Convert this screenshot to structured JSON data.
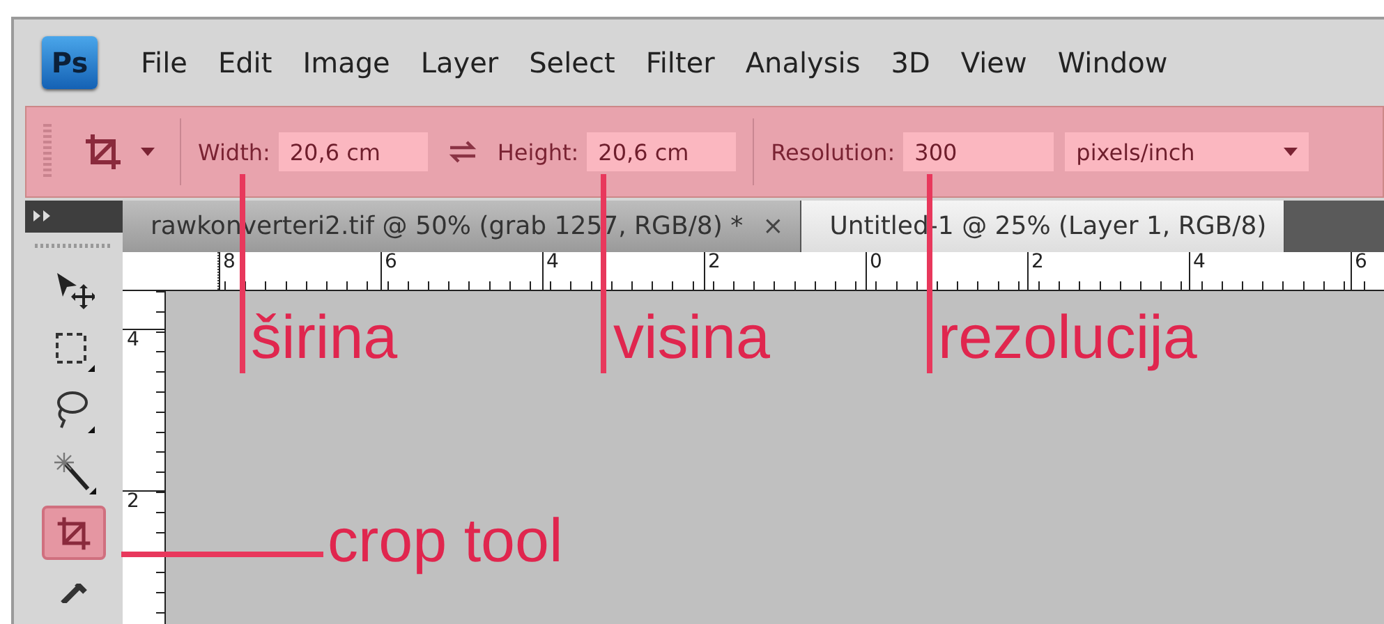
{
  "app_logo": "Ps",
  "menu_bar": {
    "items": [
      "File",
      "Edit",
      "Image",
      "Layer",
      "Select",
      "Filter",
      "Analysis",
      "3D",
      "View",
      "Window"
    ]
  },
  "options_bar": {
    "width_label": "Width:",
    "width_value": "20,6 cm",
    "height_label": "Height:",
    "height_value": "20,6 cm",
    "resolution_label": "Resolution:",
    "resolution_value": "300",
    "resolution_unit": "pixels/inch"
  },
  "tabs": [
    {
      "label": "rawkonverteri2.tif @ 50% (grab 1257, RGB/8) *",
      "close": "×",
      "selected": false
    },
    {
      "label": "Untitled-1 @ 25% (Layer 1, RGB/8)",
      "selected": true
    }
  ],
  "rulers": {
    "horizontal": [
      "8",
      "6",
      "4",
      "2",
      "0",
      "2",
      "4",
      "6"
    ],
    "vertical": [
      "4",
      "2"
    ]
  },
  "tools": [
    {
      "kind": "move",
      "selected": false
    },
    {
      "kind": "marquee",
      "selected": false
    },
    {
      "kind": "lasso",
      "selected": false
    },
    {
      "kind": "wand",
      "selected": false
    },
    {
      "kind": "crop",
      "selected": true
    },
    {
      "kind": "eyedropper",
      "selected": false
    }
  ],
  "annotations": [
    {
      "kind": "width",
      "label": "širina"
    },
    {
      "kind": "height",
      "label": "visina"
    },
    {
      "kind": "resolution",
      "label": "rezolucija"
    },
    {
      "kind": "crop",
      "label": "crop tool"
    }
  ]
}
